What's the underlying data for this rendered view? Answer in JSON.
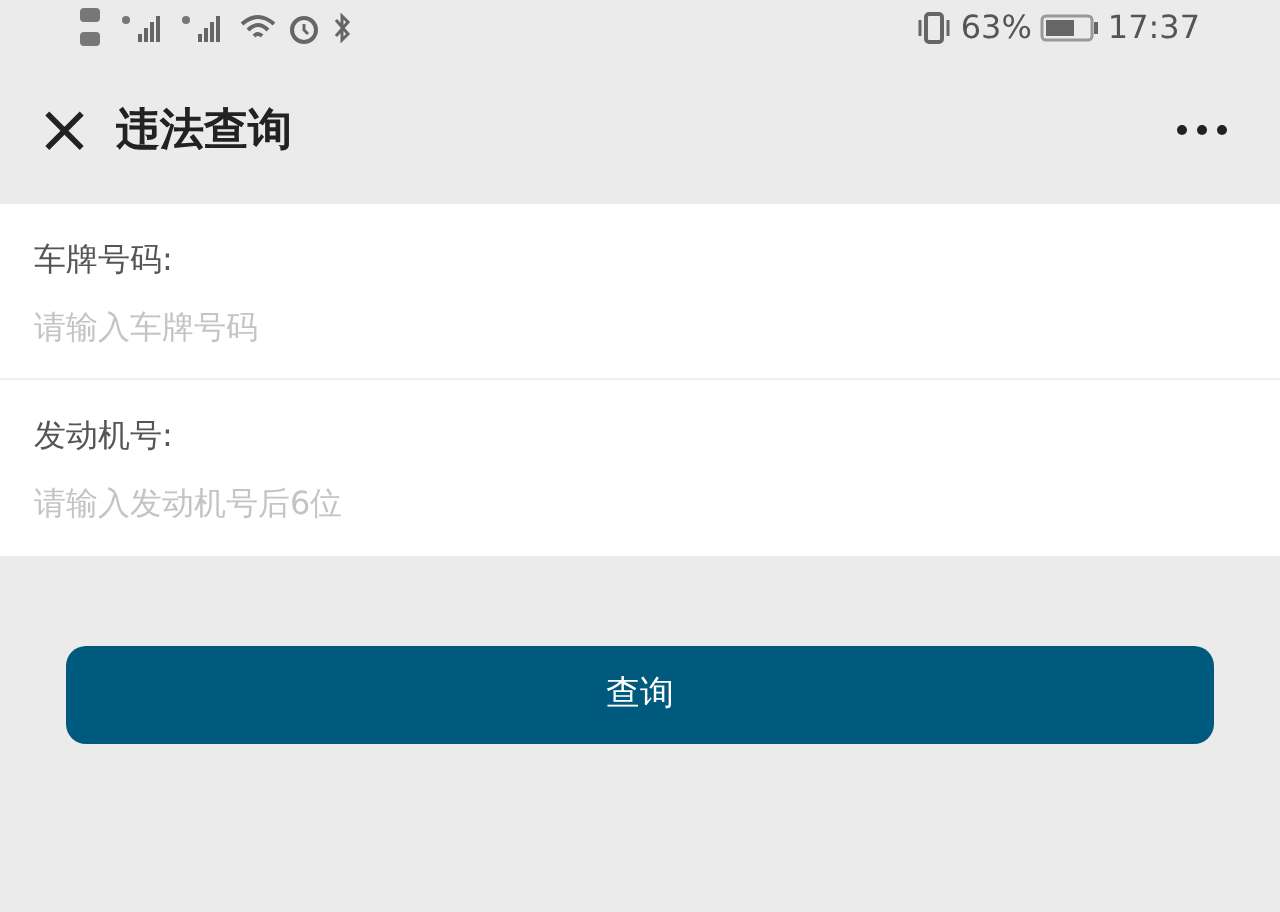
{
  "status_bar": {
    "battery_percent": "63%",
    "time": "17:37"
  },
  "header": {
    "close_symbol": "×",
    "title": "违法查询"
  },
  "fields": [
    {
      "label": "车牌号码:",
      "placeholder": "请输入车牌号码"
    },
    {
      "label": "发动机号:",
      "placeholder": "请输入发动机号后6位"
    }
  ],
  "submit_button": "查询"
}
